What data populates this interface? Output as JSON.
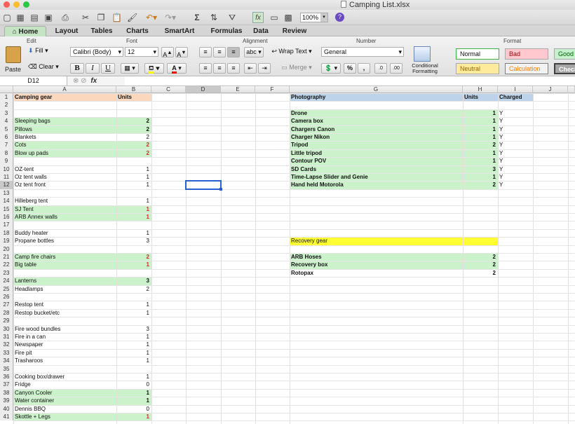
{
  "window": {
    "title": "Camping List.xlsx"
  },
  "toolbar": {
    "zoom": "100%",
    "sigma": "Σ",
    "help": "?"
  },
  "tabs": [
    "Home",
    "Layout",
    "Tables",
    "Charts",
    "SmartArt",
    "Formulas",
    "Data",
    "Review"
  ],
  "ribbon": {
    "groups": {
      "edit": "Edit",
      "font": "Font",
      "alignment": "Alignment",
      "number": "Number",
      "format": "Format"
    },
    "fill_label": "Fill",
    "clear_label": "Clear",
    "paste_label": "Paste",
    "font_name": "Calibri (Body)",
    "font_size": "12",
    "bold": "B",
    "italic": "I",
    "underline": "U",
    "wrap_text": "Wrap Text",
    "merge": "Merge",
    "abc": "abc",
    "number_format": "General",
    "percent": "%",
    "comma": ",",
    "conditional_formatting": "Conditional Formatting",
    "styles": {
      "normal": "Normal",
      "bad": "Bad",
      "good": "Good",
      "neutral": "Neutral",
      "calculation": "Calculation",
      "check": "Check C"
    }
  },
  "formula": {
    "name_box": "D12",
    "fx": "fx"
  },
  "columns": [
    "A",
    "B",
    "C",
    "D",
    "E",
    "F",
    "G",
    "H",
    "I",
    "J"
  ],
  "rows": [
    "1",
    "2",
    "3",
    "4",
    "5",
    "6",
    "7",
    "8",
    "9",
    "10",
    "11",
    "12",
    "13",
    "14",
    "15",
    "16",
    "17",
    "18",
    "19",
    "20",
    "21",
    "22",
    "23",
    "24",
    "25",
    "26",
    "27",
    "28",
    "29",
    "30",
    "31",
    "32",
    "33",
    "34",
    "35",
    "36",
    "37",
    "38",
    "39",
    "40",
    "41"
  ],
  "left_table": {
    "header": "Camping gear",
    "units_header": "Units",
    "items": [
      {
        "r": 4,
        "name": "Sleeping bags",
        "units": "2",
        "green": true,
        "red": false
      },
      {
        "r": 5,
        "name": "Pillows",
        "units": "2",
        "green": true,
        "red": false
      },
      {
        "r": 6,
        "name": "Blankets",
        "units": "2",
        "green": false,
        "red": false
      },
      {
        "r": 7,
        "name": "Cots",
        "units": "2",
        "green": true,
        "red": true
      },
      {
        "r": 8,
        "name": "Blow up pads",
        "units": "2",
        "green": true,
        "red": true
      },
      {
        "r": 10,
        "name": "OZ-tent",
        "units": "1",
        "green": false,
        "red": false
      },
      {
        "r": 11,
        "name": "Oz tent walls",
        "units": "1",
        "green": false,
        "red": false
      },
      {
        "r": 12,
        "name": "Oz tent front",
        "units": "1",
        "green": false,
        "red": false
      },
      {
        "r": 14,
        "name": "Hilleberg tent",
        "units": "1",
        "green": false,
        "red": false
      },
      {
        "r": 15,
        "name": "SJ Tent",
        "units": "1",
        "green": true,
        "red": true
      },
      {
        "r": 16,
        "name": "ARB Annex walls",
        "units": "1",
        "green": true,
        "red": true
      },
      {
        "r": 18,
        "name": "Buddy heater",
        "units": "1",
        "green": false,
        "red": false
      },
      {
        "r": 19,
        "name": "Propane bottles",
        "units": "3",
        "green": false,
        "red": false
      },
      {
        "r": 21,
        "name": "Camp fire chairs",
        "units": "2",
        "green": true,
        "red": true
      },
      {
        "r": 22,
        "name": "Big table",
        "units": "1",
        "green": true,
        "red": true
      },
      {
        "r": 24,
        "name": "Lanterns",
        "units": "3",
        "green": true,
        "red": false
      },
      {
        "r": 25,
        "name": "Headlamps",
        "units": "2",
        "green": false,
        "red": false
      },
      {
        "r": 27,
        "name": "Restop tent",
        "units": "1",
        "green": false,
        "red": false
      },
      {
        "r": 28,
        "name": "Restop bucket/etc",
        "units": "1",
        "green": false,
        "red": false
      },
      {
        "r": 30,
        "name": "Fire wood bundles",
        "units": "3",
        "green": false,
        "red": false
      },
      {
        "r": 31,
        "name": "Fire in a can",
        "units": "1",
        "green": false,
        "red": false
      },
      {
        "r": 32,
        "name": "Newspaper",
        "units": "1",
        "green": false,
        "red": false
      },
      {
        "r": 33,
        "name": "Fire pit",
        "units": "1",
        "green": false,
        "red": false
      },
      {
        "r": 34,
        "name": "Trasharoos",
        "units": "1",
        "green": false,
        "red": false
      },
      {
        "r": 36,
        "name": "Cooking box/drawer",
        "units": "1",
        "green": false,
        "red": false
      },
      {
        "r": 37,
        "name": "Fridge",
        "units": "0",
        "green": false,
        "red": false
      },
      {
        "r": 38,
        "name": "Canyon Cooler",
        "units": "1",
        "green": true,
        "red": false
      },
      {
        "r": 39,
        "name": "Water container",
        "units": "1",
        "green": true,
        "red": false
      },
      {
        "r": 40,
        "name": "Dennis BBQ",
        "units": "0",
        "green": false,
        "red": false
      },
      {
        "r": 41,
        "name": "Skottle + Legs",
        "units": "1",
        "green": true,
        "red": true
      }
    ]
  },
  "photo_table": {
    "header": "Photography",
    "units_header": "Units",
    "charged_header": "Charged",
    "items": [
      {
        "r": 3,
        "name": "Drone",
        "units": "1",
        "charged": "Y"
      },
      {
        "r": 4,
        "name": "Camera box",
        "units": "1",
        "charged": "Y"
      },
      {
        "r": 5,
        "name": "Chargers Canon",
        "units": "1",
        "charged": "Y"
      },
      {
        "r": 6,
        "name": "Charger Nikon",
        "units": "1",
        "charged": "Y"
      },
      {
        "r": 7,
        "name": "Tripod",
        "units": "2",
        "charged": "Y"
      },
      {
        "r": 8,
        "name": "Little tripod",
        "units": "1",
        "charged": "Y"
      },
      {
        "r": 9,
        "name": "Contour POV",
        "units": "1",
        "charged": "Y"
      },
      {
        "r": 10,
        "name": "SD Cards",
        "units": "3",
        "charged": "Y"
      },
      {
        "r": 11,
        "name": "Time-Lapse Slider and Genie",
        "units": "1",
        "charged": "Y"
      },
      {
        "r": 12,
        "name": "Hand held Motorola",
        "units": "2",
        "charged": "Y"
      }
    ]
  },
  "recovery_table": {
    "header": "Recovery gear",
    "items": [
      {
        "r": 21,
        "name": "ARB Hoses",
        "units": "2",
        "green": true
      },
      {
        "r": 22,
        "name": "Recovery box",
        "units": "2",
        "green": true
      },
      {
        "r": 23,
        "name": "Rotopax",
        "units": "2",
        "green": false
      }
    ]
  },
  "colors": {
    "peach": "#fbd8bd",
    "green": "#ccf2cc",
    "blue": "#bcd3ea",
    "yellow": "#ffff33",
    "select": "#2a5fd1",
    "red_text": "#e02424"
  }
}
